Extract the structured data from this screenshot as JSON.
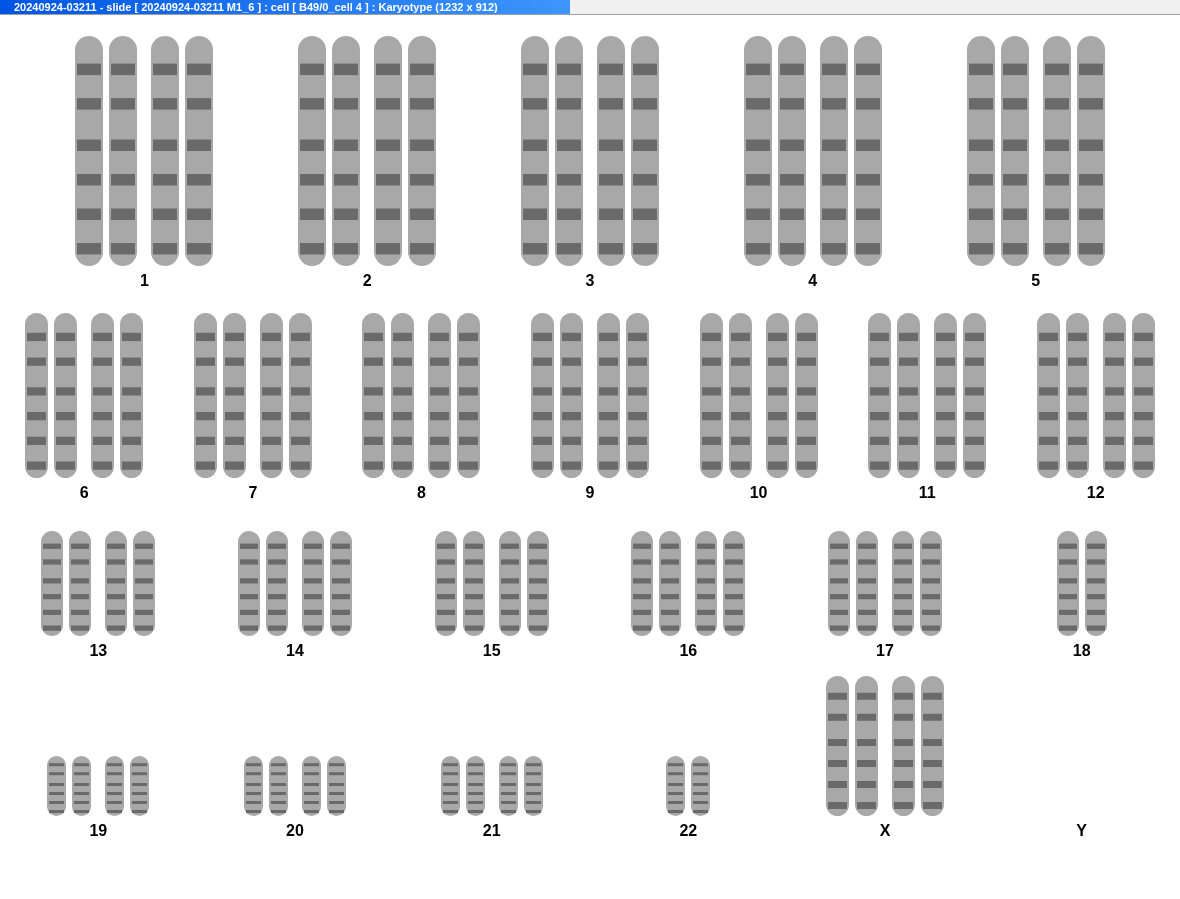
{
  "window": {
    "title": "20240924-03211 - slide [ 20240924-03211 M1_6 ] : cell [ B49/0_cell 4 ] : Karyotype  (1232 x 912)"
  },
  "karyotype": {
    "rows": [
      {
        "chromosomes": [
          {
            "label": "1",
            "kind": "pair"
          },
          {
            "label": "2",
            "kind": "pair"
          },
          {
            "label": "3",
            "kind": "pair"
          },
          {
            "label": "4",
            "kind": "pair"
          },
          {
            "label": "5",
            "kind": "pair"
          }
        ]
      },
      {
        "chromosomes": [
          {
            "label": "6",
            "kind": "pair"
          },
          {
            "label": "7",
            "kind": "pair"
          },
          {
            "label": "8",
            "kind": "pair"
          },
          {
            "label": "9",
            "kind": "pair"
          },
          {
            "label": "10",
            "kind": "pair"
          },
          {
            "label": "11",
            "kind": "pair"
          },
          {
            "label": "12",
            "kind": "pair"
          }
        ]
      },
      {
        "chromosomes": [
          {
            "label": "13",
            "kind": "pair"
          },
          {
            "label": "14",
            "kind": "pair"
          },
          {
            "label": "15",
            "kind": "pair"
          },
          {
            "label": "16",
            "kind": "pair"
          },
          {
            "label": "17",
            "kind": "pair"
          },
          {
            "label": "18",
            "kind": "single"
          }
        ]
      },
      {
        "chromosomes": [
          {
            "label": "19",
            "kind": "pair"
          },
          {
            "label": "20",
            "kind": "pair"
          },
          {
            "label": "21",
            "kind": "pair"
          },
          {
            "label": "22",
            "kind": "single"
          },
          {
            "label": "X",
            "kind": "pair"
          },
          {
            "label": "Y",
            "kind": "none"
          }
        ]
      }
    ]
  }
}
